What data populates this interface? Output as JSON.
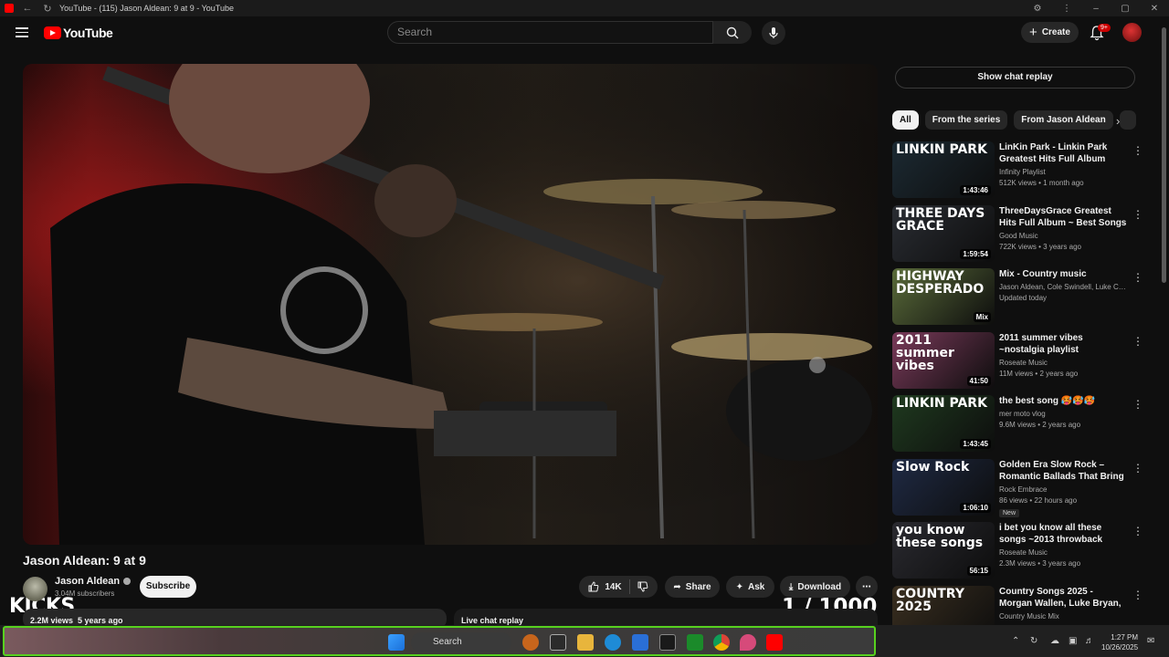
{
  "window": {
    "title": "YouTube - (115) Jason Aldean: 9 at 9 - YouTube"
  },
  "header": {
    "logo_text": "YouTube",
    "search_placeholder": "Search",
    "create_label": "Create",
    "notification_count": "9+"
  },
  "video": {
    "title": "Jason Aldean: 9 at 9",
    "channel": "Jason Aldean",
    "subscribers": "3.04M subscribers",
    "subscribe_label": "Subscribe",
    "likes": "14K",
    "share_label": "Share",
    "ask_label": "Ask",
    "download_label": "Download",
    "views_age": "2.2M views  5 years ago",
    "live_chat_label": "Live chat replay",
    "overlay_left": "KICKS",
    "overlay_counter": "1  / 1000"
  },
  "sidebar": {
    "chat_replay_button": "Show chat replay",
    "chips": [
      "All",
      "From the series",
      "From Jason Aldean"
    ],
    "recommendations": [
      {
        "title": "LinKin Park - Linkin Park Greatest Hits Full Album 2025 ...",
        "channel": "Infinity Playlist",
        "meta": "512K views • 1 month ago",
        "duration": "1:43:46",
        "thumb_text": "LINKIN PARK",
        "thumb_color": "#1c2a33"
      },
      {
        "title": "ThreeDaysGrace Greatest Hits Full Album ~ Best Songs Of ...",
        "channel": "Good Music",
        "meta": "722K views • 3 years ago",
        "duration": "1:59:54",
        "thumb_text": "THREE DAYS GRACE",
        "thumb_color": "#2a2d33"
      },
      {
        "title": "Mix - Country music",
        "channel": "Jason Aldean, Cole Swindell, Luke Comb...",
        "meta": "Updated today",
        "duration": "Mix",
        "thumb_text": "HIGHWAY DESPERADO",
        "thumb_color": "#5a6b3a"
      },
      {
        "title": "2011 summer vibes ~nostalgia playlist",
        "channel": "Roseate Music",
        "meta": "11M views • 2 years ago",
        "duration": "41:50",
        "thumb_text": "2011 summer vibes",
        "thumb_color": "#7a3a5a"
      },
      {
        "title": "the best song 🥵🥵🥵",
        "channel": "mer moto vlog",
        "meta": "9.6M views • 2 years ago",
        "duration": "1:43:45",
        "thumb_text": "LINKIN PARK",
        "thumb_color": "#1f3a1f"
      },
      {
        "title": "Golden Era Slow Rock – Romantic Ballads That Bring ...",
        "channel": "Rock Embrace",
        "meta": "86 views • 22 hours ago",
        "duration": "1:06:10",
        "thumb_text": "Slow Rock",
        "thumb_color": "#1f2a44",
        "badge": "New"
      },
      {
        "title": "i bet you know all these songs ~2013 throwback nostalgia ...",
        "channel": "Roseate Music",
        "meta": "2.3M views • 3 years ago",
        "duration": "56:15",
        "thumb_text": "you know these songs",
        "thumb_color": "#2a2a30"
      },
      {
        "title": "Country Songs 2025 - Morgan Wallen, Luke Bryan, Luke ...",
        "channel": "Country Music Mix",
        "meta": "",
        "duration": "",
        "thumb_text": "COUNTRY 2025",
        "thumb_color": "#3a2f20"
      }
    ]
  },
  "taskbar": {
    "search_label": "Search",
    "time": "1:27 PM",
    "date": "10/26/2025"
  },
  "colors": {
    "accent_red": "#ff0000",
    "taskbar_highlight": "#57d11f"
  }
}
